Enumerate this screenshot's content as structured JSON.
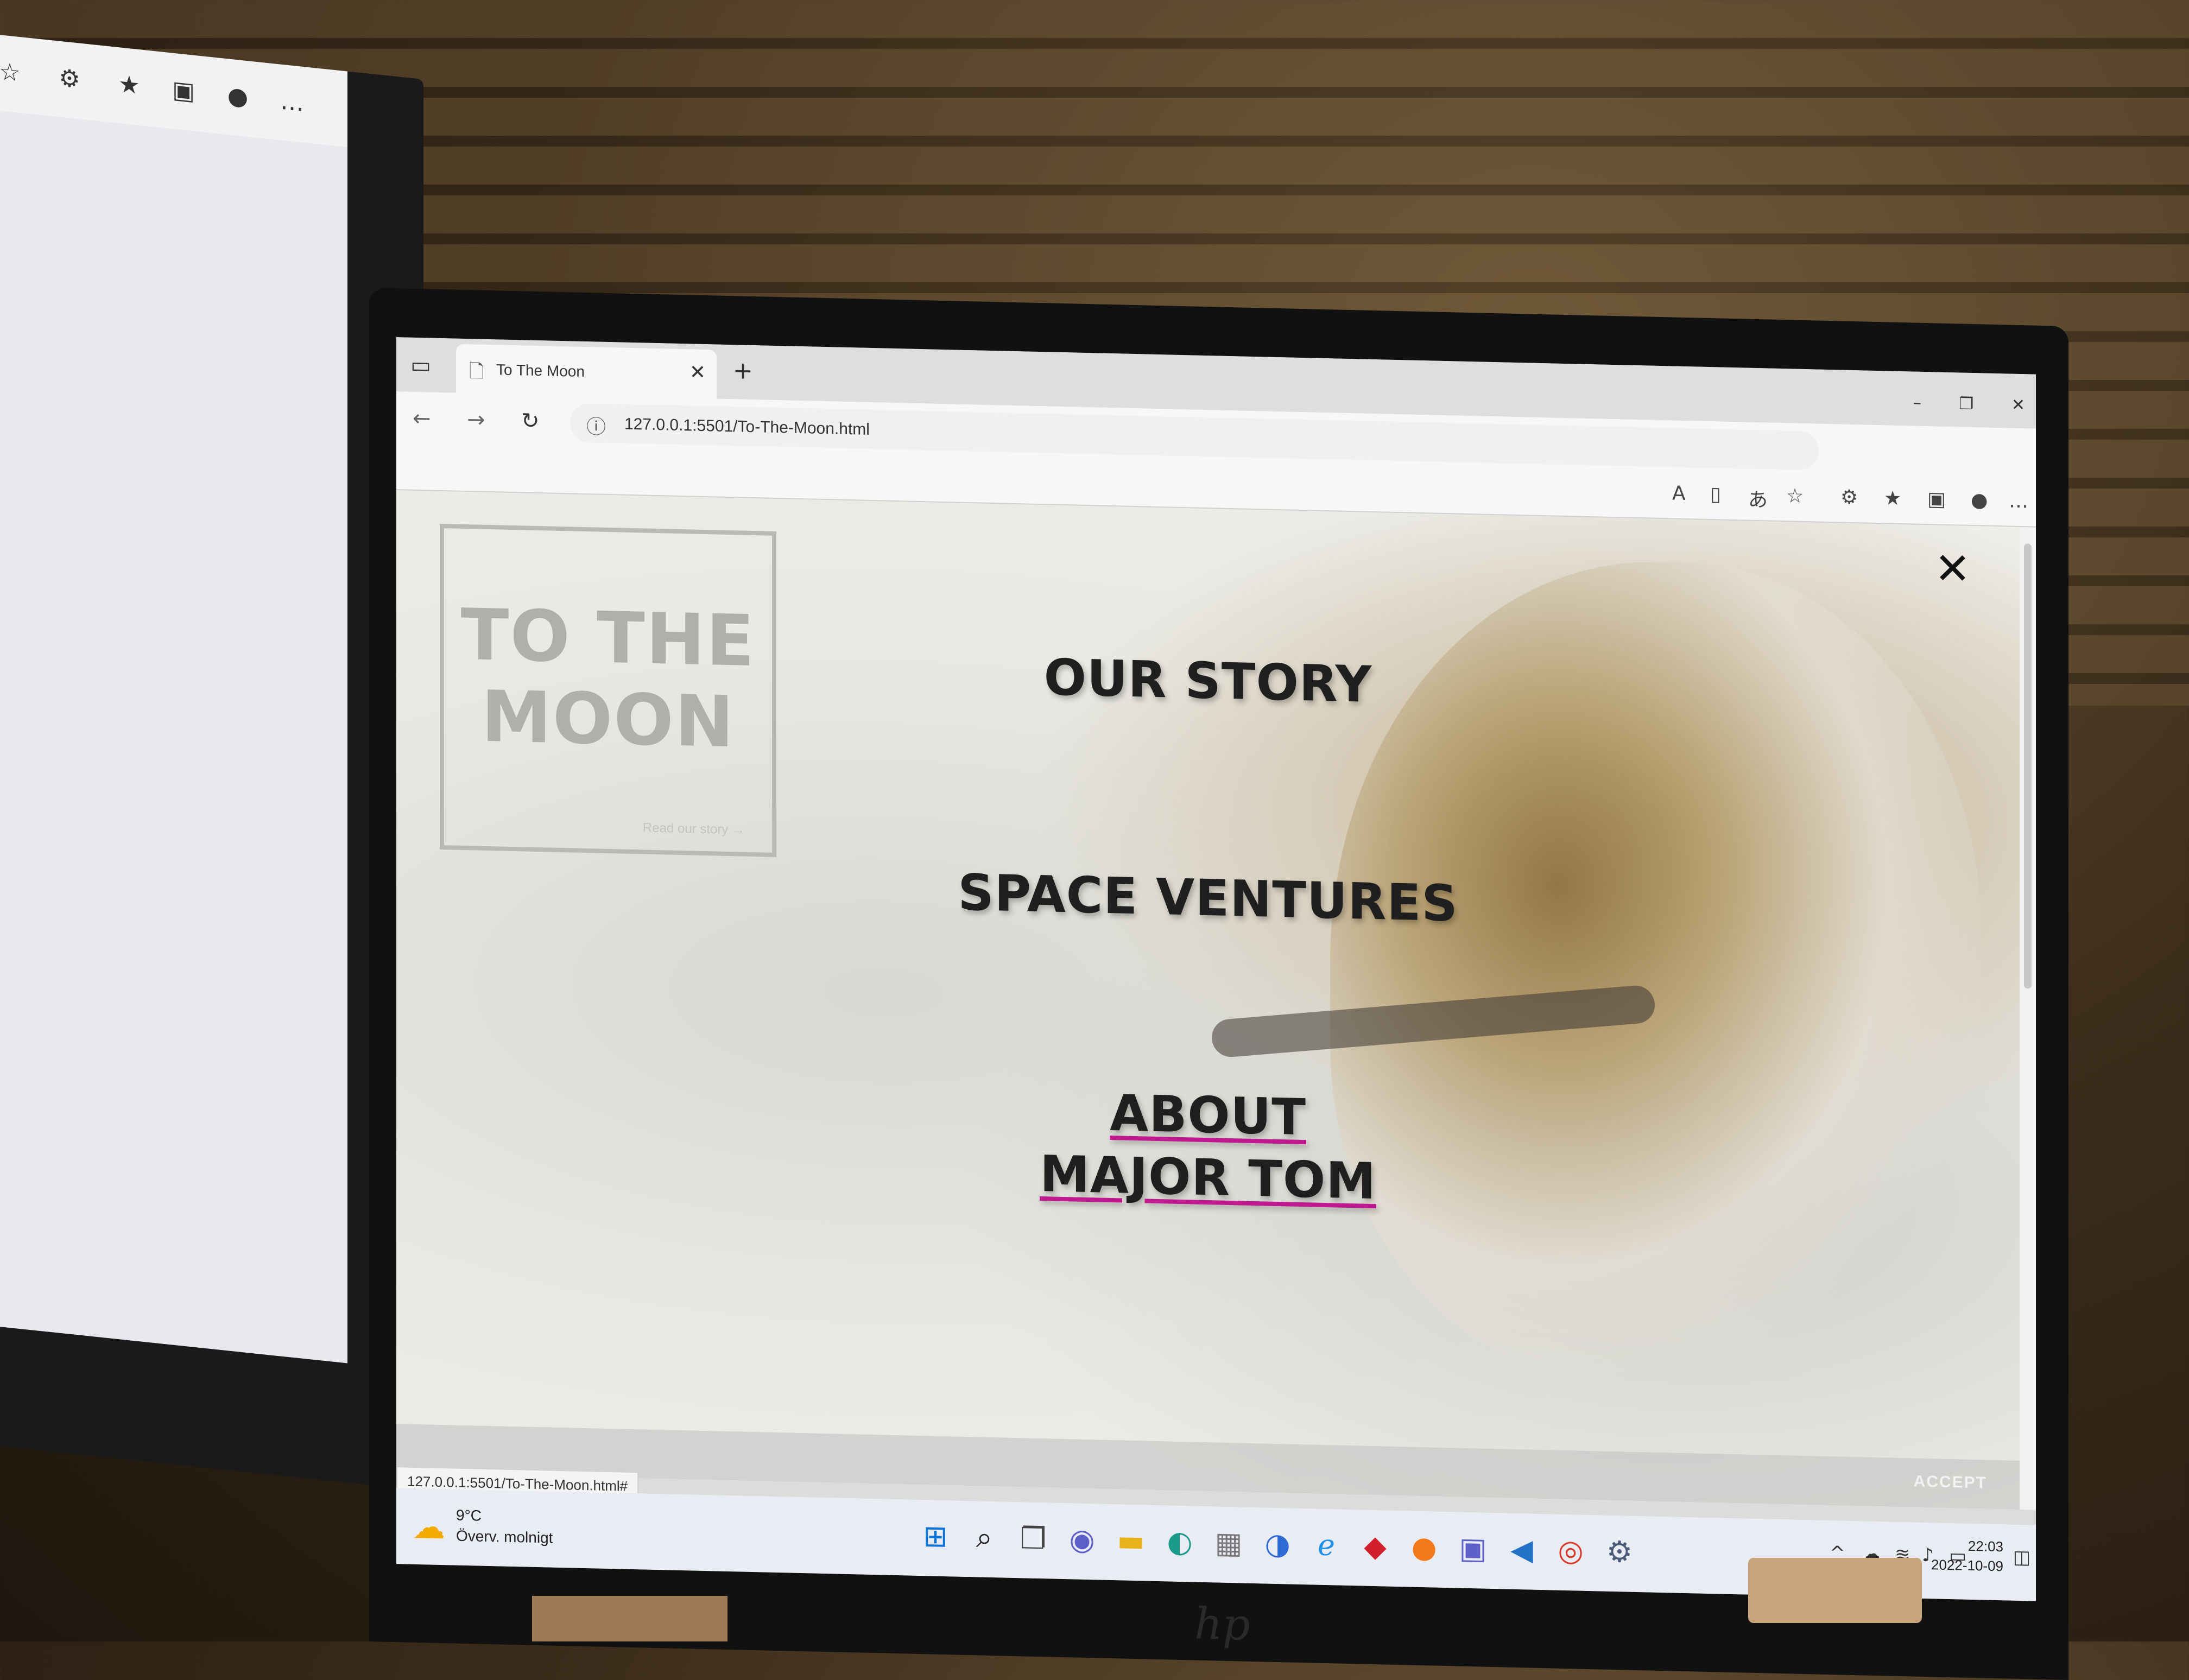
{
  "left_monitor": {
    "toolbar_icons": [
      "favorite-star-icon",
      "extensions-icon",
      "favorites-icon",
      "collections-icon",
      "profile-icon",
      "more-icon"
    ]
  },
  "browser": {
    "tab": {
      "title": "To The Moon"
    },
    "address": {
      "url": "127.0.0.1:5501/To-The-Moon.html"
    },
    "status_url": "127.0.0.1:5501/To-The-Moon.html#"
  },
  "page": {
    "logo": {
      "line1": "TO THE",
      "line2": "MOON",
      "link": "Read our story →"
    },
    "close_glyph": "✕",
    "menu": {
      "our_story": "OUR STORY",
      "space_ventures": "SPACE VENTURES",
      "about_line1": "ABOUT",
      "about_line2": "MAJOR TOM"
    },
    "cookie": {
      "accept": "ACCEPT"
    },
    "accent_color": "#c0188f"
  },
  "taskbar": {
    "weather": {
      "temp": "9°C",
      "desc": "Överv. molnigt"
    },
    "clock": {
      "time": "22:03",
      "date": "2022-10-09"
    },
    "icons": [
      "windows-start-icon",
      "search-icon",
      "task-view-icon",
      "teams-chat-icon",
      "file-explorer-icon",
      "edge-icon",
      "store-icon",
      "edge-dev-icon",
      "internet-explorer-icon",
      "mcafee-icon",
      "firefox-icon",
      "teams-icon",
      "vscode-icon",
      "chrome-icon",
      "settings-icon"
    ]
  }
}
